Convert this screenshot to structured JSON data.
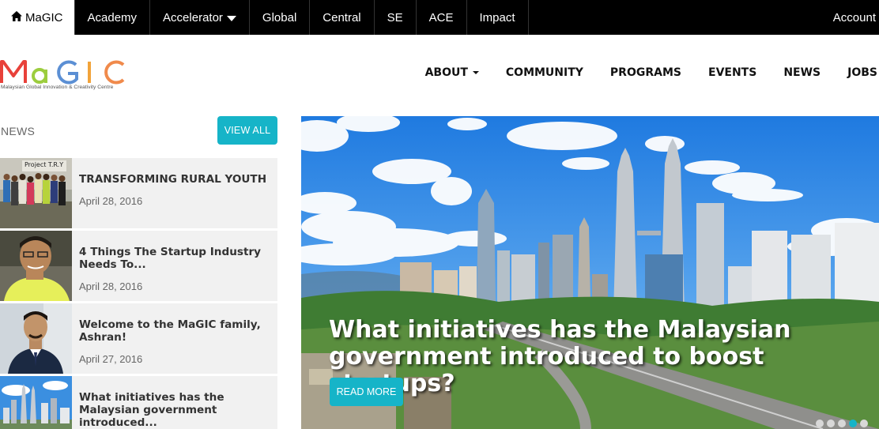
{
  "topnav": {
    "items": [
      {
        "label": "MaGIC",
        "active": true,
        "icon": "home-icon"
      },
      {
        "label": "Academy"
      },
      {
        "label": "Accelerator",
        "dropdown": true
      },
      {
        "label": "Global"
      },
      {
        "label": "Central"
      },
      {
        "label": "SE"
      },
      {
        "label": "ACE"
      },
      {
        "label": "Impact"
      }
    ],
    "account": "Account"
  },
  "logo": {
    "text": "MaGIC",
    "tagline": "Malaysian Global Innovation & Creativity Centre"
  },
  "mainnav": {
    "items": [
      {
        "label": "ABOUT",
        "dropdown": true
      },
      {
        "label": "COMMUNITY"
      },
      {
        "label": "PROGRAMS"
      },
      {
        "label": "EVENTS"
      },
      {
        "label": "NEWS"
      },
      {
        "label": "JOBS"
      }
    ]
  },
  "news": {
    "heading": "NEWS",
    "view_all": "VIEW ALL",
    "items": [
      {
        "title": "TRANSFORMING RURAL YOUTH",
        "date": "April 28, 2016",
        "thumb_text": "Project T.R.Y"
      },
      {
        "title": "4 Things The Startup Industry Needs To...",
        "date": "April 28, 2016"
      },
      {
        "title": "Welcome to the MaGIC family, Ashran!",
        "date": "April 27, 2016"
      },
      {
        "title": "What initiatives has the Malaysian government introduced...",
        "date": ""
      }
    ]
  },
  "hero": {
    "headline": "What initiatives has the Malaysian government introduced to boost startups?",
    "read_more": "READ MORE",
    "slides": 5,
    "active_slide": 4
  },
  "colors": {
    "accent": "#16b4c8",
    "topbar": "#000000"
  }
}
